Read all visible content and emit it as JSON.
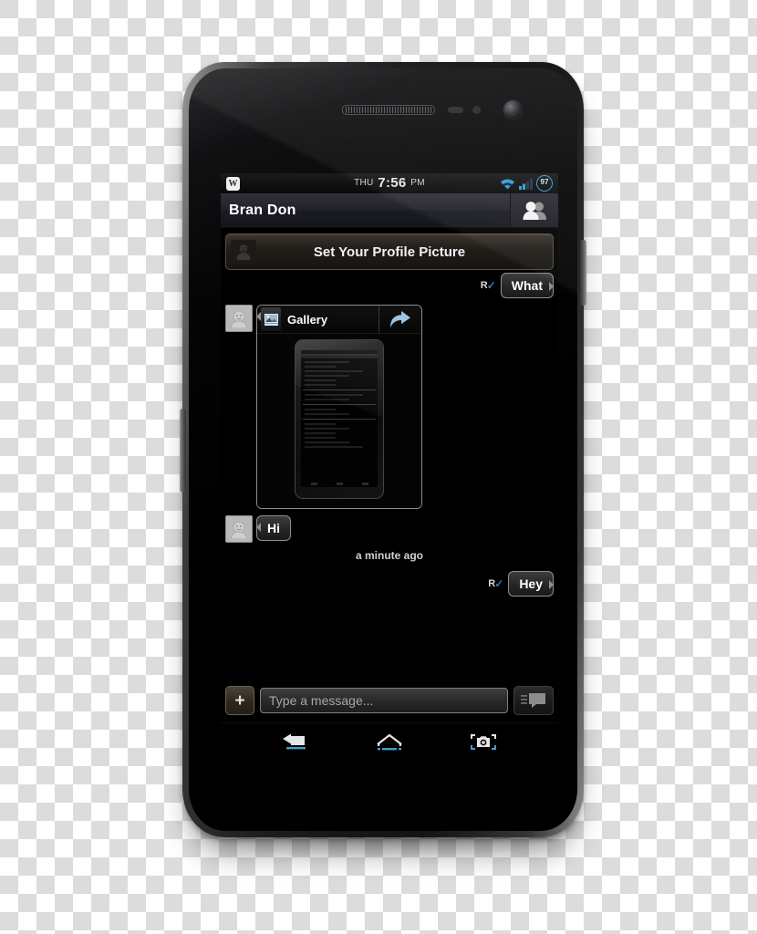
{
  "device": {
    "name": "android-smartphone",
    "hardware": {
      "earpiece": "earpiece-speaker",
      "front_camera": "front-camera",
      "proximity_sensor": "proximity-sensor",
      "light_sensor": "light-sensor",
      "volume_button": "volume-rocker",
      "power_button": "power-button"
    }
  },
  "status_bar": {
    "notification_icon": "W",
    "day_of_week": "THU",
    "time": "7:56",
    "meridiem": "PM",
    "wifi_icon": "wifi-icon",
    "signal_icon": "cellular-signal-icon",
    "battery_level": "97",
    "accent_color": "#2e9fd4"
  },
  "action_bar": {
    "title": "Bran Don",
    "contacts_icon": "contacts-people-icon"
  },
  "profile_banner": {
    "label": "Set Your Profile Picture",
    "avatar_icon": "profile-placeholder-icon"
  },
  "conversation": {
    "messages": [
      {
        "id": "msg-what",
        "direction": "outgoing",
        "type": "text",
        "text": "What",
        "receipt": "R",
        "receipt_tick": "✓"
      },
      {
        "id": "msg-gallery",
        "direction": "incoming",
        "type": "attachment",
        "app_label": "Gallery",
        "app_icon": "gallery-image-icon",
        "share_icon": "share-arrow-icon",
        "thumbnail": "tablet-screenshot-thumbnail"
      },
      {
        "id": "msg-hi",
        "direction": "incoming",
        "type": "text",
        "text": "Hi"
      },
      {
        "id": "timestamp-1",
        "type": "timestamp",
        "text": "a minute ago"
      },
      {
        "id": "msg-hey",
        "direction": "outgoing",
        "type": "text",
        "text": "Hey",
        "receipt": "R",
        "receipt_tick": "✓"
      }
    ]
  },
  "compose": {
    "attach_label": "+",
    "attach_icon": "plus-icon",
    "input_value": "",
    "input_placeholder": "Type a message...",
    "send_icon": "message-send-icon"
  },
  "navigation": {
    "back_icon": "back-arrow-icon",
    "home_icon": "home-icon",
    "camera_icon": "camera-screenshot-icon",
    "accent_color": "#3da0c7"
  }
}
